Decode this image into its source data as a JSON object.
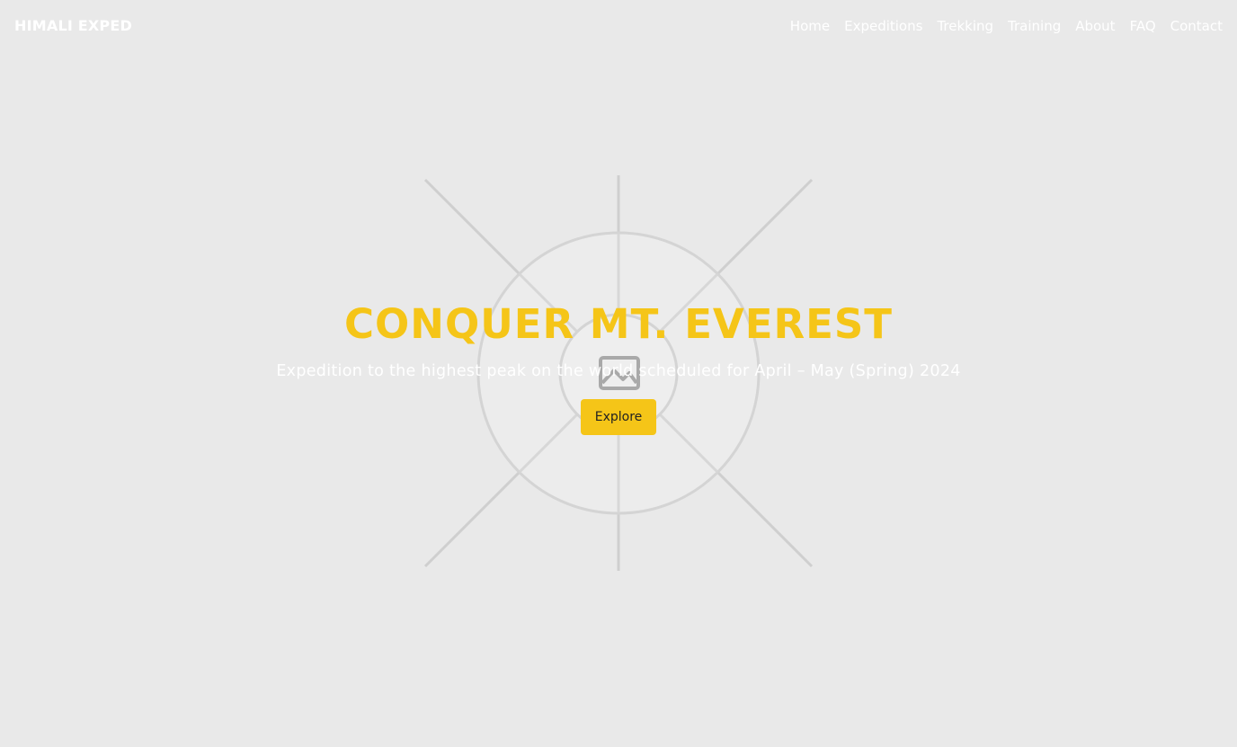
{
  "nav": {
    "brand": "HIMALI EXPED",
    "links": [
      "Home",
      "Expeditions",
      "Trekking",
      "Training",
      "About",
      "FAQ",
      "Contact"
    ]
  },
  "hero": {
    "title": "CONQUER MT. EVEREST",
    "subtitle": "Expedition to the highest peak on the world scheduled for April – May (Spring) 2024",
    "button_label": "Explore",
    "background_image_icon": "image-placeholder-icon"
  },
  "colors": {
    "accent": "#f5c518",
    "background": "#e9e9e9",
    "nav_text": "#ffffff"
  }
}
